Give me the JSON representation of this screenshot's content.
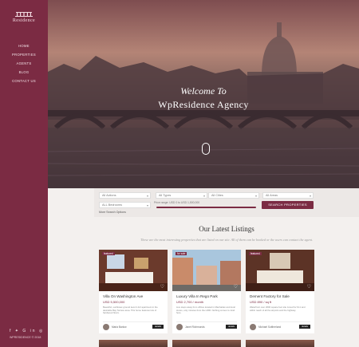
{
  "brand": {
    "name": "Residence"
  },
  "nav": {
    "items": [
      {
        "label": "HOME"
      },
      {
        "label": "PROPERTIES"
      },
      {
        "label": "AGENTS"
      },
      {
        "label": "BLOG"
      },
      {
        "label": "CONTACT US"
      }
    ]
  },
  "social": {
    "icons": [
      "facebook-icon",
      "twitter-icon",
      "google-plus-icon",
      "linkedin-icon",
      "instagram-icon"
    ],
    "text": "f  🐦  G+  in  ◎"
  },
  "copyright": "WPRESIDENCE © 2018",
  "hero": {
    "welcome": "Welcome To",
    "agency": "WpResidence Agency"
  },
  "search": {
    "select1": "All Actions",
    "select2": "All Types",
    "select3": "All Cities",
    "select4": "All Areas",
    "select5": "ALL Bedrooms",
    "price_label": "Price range: USD 0 to USD 1,500,000",
    "button": "SEARCH PROPERTIES",
    "more": "More Search Options"
  },
  "listings": {
    "title": "Our Latest Listings",
    "subtitle": "These are the most interesting properties that are listed on our site. All of them can be booked or the users can contact the agent.",
    "cards": [
      {
        "tag": "featured",
        "title": "Villa On Washington Ave",
        "price": "USD 5,500,000",
        "desc": "Beautiful, sunflower-ground level 2-1/2 apartment in the desirable Bay Terrace area. This home features lots of hardwood floors.",
        "agent": "Maria Barlow",
        "button": "details"
      },
      {
        "tag": "for sale",
        "title": "Luxury Villa In Rego Park",
        "price": "USD 2,700 / month",
        "desc": "Live steps away from offices located in Manhattan and local stores, only minutes from the LIRR. Nothing comes to mind here.",
        "agent": "Janet Richmonds",
        "button": "details"
      },
      {
        "tag": "featured",
        "title": "Dement Factory for Sale",
        "price": "USD 890 / sq ft",
        "desc": "Waterfront over 2000 square foot site zoned for M-1 and within reach of all the airports and the highway.",
        "agent": "Michael Suttherland",
        "button": "details"
      }
    ]
  }
}
